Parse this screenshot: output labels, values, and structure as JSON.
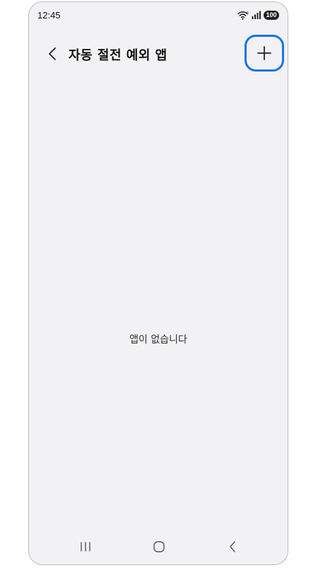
{
  "status_bar": {
    "time": "12:45",
    "wifi_icon": "wifi-icon",
    "signal_icon": "signal-icon",
    "battery_level": "100"
  },
  "header": {
    "back_icon": "chevron-left-icon",
    "title": "자동 절전 예외 앱",
    "add_icon": "plus-icon",
    "highlight_color": "#1a73e8"
  },
  "main": {
    "empty_message": "앱이 없습니다"
  },
  "navigation": {
    "recents_icon": "recent-apps-icon",
    "home_icon": "home-icon",
    "back_icon": "back-icon"
  }
}
